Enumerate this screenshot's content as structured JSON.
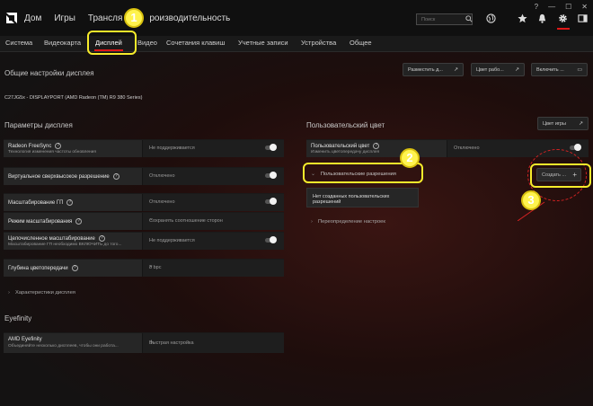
{
  "nav": {
    "home": "Дом",
    "games": "Игры",
    "stream_left": "Трансля",
    "stream_right": "роизводительность"
  },
  "search": {
    "placeholder": "Поиск"
  },
  "tabs": {
    "system": "Система",
    "videocard": "Видеокарта",
    "display": "Дисплей",
    "video": "Видео",
    "hotkeys": "Сочетания клавиш",
    "accounts": "Учетные записи",
    "devices": "Устройства",
    "general": "Общее"
  },
  "general_settings": {
    "title": "Общие настройки дисплея",
    "btn_arrange": "Разместить д...",
    "btn_color": "Цвет рабо...",
    "btn_enable": "Включить ..."
  },
  "monitor": "C27JG5x - DISPLAYPORT (AMD Radeon (TM) R9 380 Series)",
  "display_params": {
    "title": "Параметры дисплея",
    "freesync_label": "Radeon FreeSync",
    "freesync_sub": "Технология изменения частоты обновления",
    "freesync_value": "Не поддерживается",
    "vsr_label": "Виртуальное сверхвысокое разрешение",
    "vsr_value": "Отключено",
    "gpu_scaling_label": "Масштабирование ГП",
    "gpu_scaling_value": "Отключено",
    "scaling_mode_label": "Режим масштабирования",
    "scaling_mode_value": "Сохранять соотношение сторон",
    "integer_label": "Целочисленное масштабирование",
    "integer_sub": "Масштабирование ГП необходимо ВКЛЮЧИТЬ до того...",
    "integer_value": "Не поддерживается",
    "depth_label": "Глубина цветопередачи",
    "depth_value": "8 bpc",
    "characteristics": "Характеристики дисплея"
  },
  "eyefinity": {
    "title": "Eyefinity",
    "label": "AMD Eyefinity",
    "sub": "Объединяйте несколько дисплеев, чтобы они работа...",
    "value": "Быстрая настройка"
  },
  "custom_color": {
    "title": "Пользовательский цвет",
    "btn_games": "Цвет игры",
    "label": "Пользовательский цвет",
    "sub": "Изменить цветопередачу дисплея",
    "value": "Отключено"
  },
  "custom_res": {
    "label": "Пользовательские разрешения",
    "empty": "Нет созданных пользовательских разрешений",
    "create": "Создать ...",
    "override": "Переопределение настроек"
  },
  "annotations": {
    "one": "1",
    "two": "2",
    "three": "3"
  },
  "colors": {
    "accent": "#e01717",
    "highlight": "#f7ec2b",
    "badge": "#fff34d"
  }
}
